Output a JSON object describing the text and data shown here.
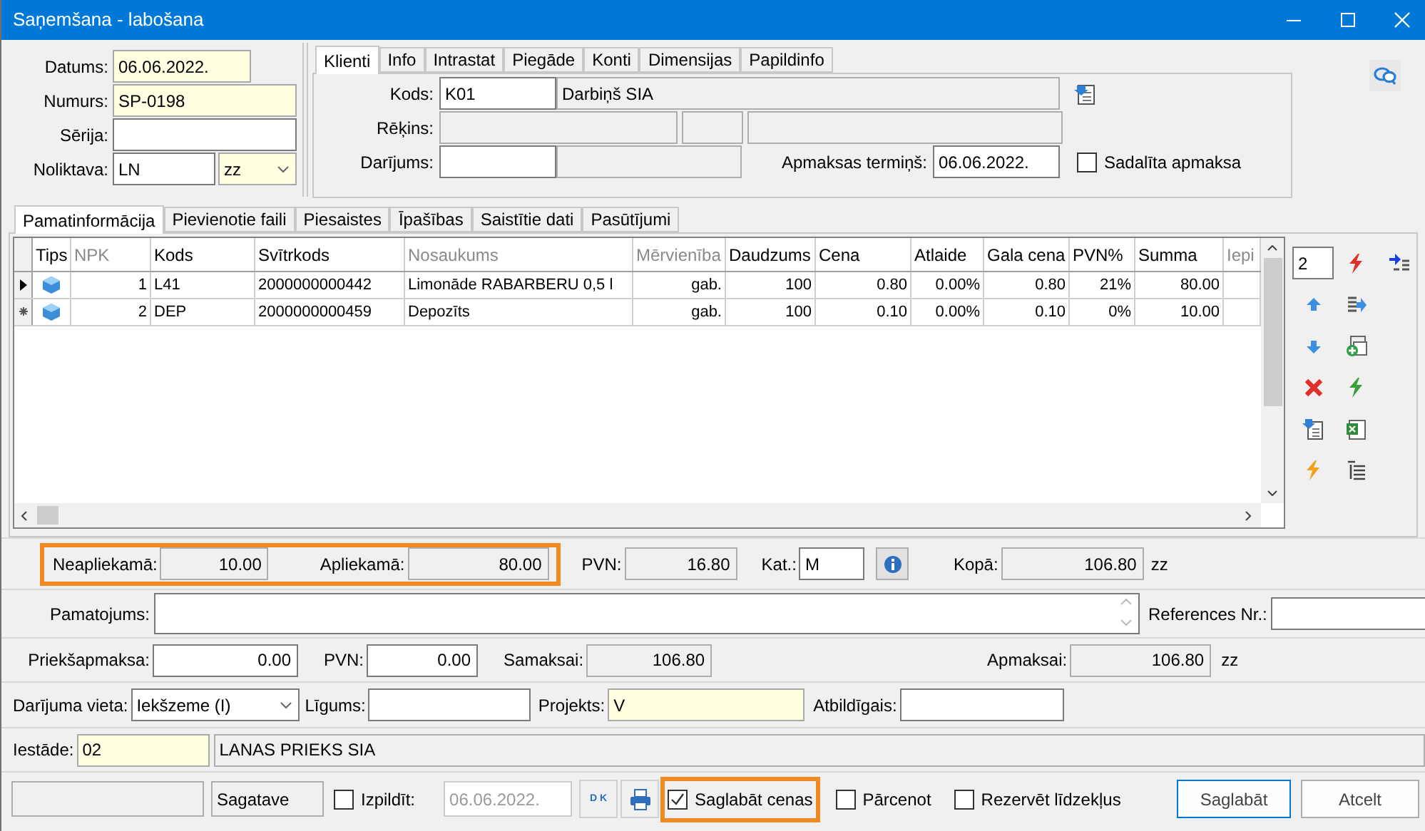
{
  "window": {
    "title": "Saņemšana - labošana"
  },
  "document_fields": [
    {
      "label": "Datums:",
      "value": "06.06.2022.",
      "kind": "text",
      "required": true,
      "readonly": false
    },
    {
      "label": "Numurs:",
      "value": "SP-0198",
      "kind": "text",
      "required": true,
      "readonly": false
    },
    {
      "label": "Sērija:",
      "kind": "text",
      "required": false,
      "readonly": false
    },
    {
      "label": "Noliktava:",
      "value": "LN",
      "kind": "text",
      "required": false,
      "readonly": false
    },
    {
      "value": "zz",
      "kind": "dropdown",
      "required": true,
      "readonly": false
    }
  ],
  "header_tabs": [
    {
      "label": "Klienti",
      "selected": true
    },
    {
      "label": "Info",
      "selected": false
    },
    {
      "label": "Intrastat",
      "selected": false
    },
    {
      "label": "Piegāde",
      "selected": false
    },
    {
      "label": "Konti",
      "selected": false
    },
    {
      "label": "Dimensijas",
      "selected": false
    },
    {
      "label": "Papildinfo",
      "selected": false
    }
  ],
  "client_fields": [
    {
      "label": "Kods:",
      "value": "K01",
      "required": false,
      "readonly": false
    },
    {
      "value": "Darbiņš SIA",
      "required": false,
      "readonly": true
    },
    {
      "label": "Rēķins:",
      "required": false,
      "readonly": true
    },
    {
      "required": false,
      "readonly": true
    },
    {
      "required": false,
      "readonly": true
    },
    {
      "label": "Darījums:",
      "required": false,
      "readonly": false
    },
    {
      "required": false,
      "readonly": true
    },
    {
      "label": "Apmaksas termiņš:",
      "value": "06.06.2022.",
      "required": false,
      "readonly": false
    }
  ],
  "split_payment": {
    "label": "Sadalīta apmaksa",
    "checked": false
  },
  "detail_tabs": [
    {
      "label": "Pamatinformācija",
      "selected": true
    },
    {
      "label": "Pievienotie faili",
      "selected": false
    },
    {
      "label": "Piesaistes",
      "selected": false
    },
    {
      "label": "Īpašības",
      "selected": false
    },
    {
      "label": "Saistītie dati",
      "selected": false
    },
    {
      "label": "Pasūtījumi",
      "selected": false
    }
  ],
  "table": {
    "columns": [
      {
        "label": "Tips",
        "dimmed": false
      },
      {
        "label": "NPK",
        "dimmed": true
      },
      {
        "label": "Kods",
        "dimmed": false
      },
      {
        "label": "Svītrkods",
        "dimmed": false
      },
      {
        "label": "Nosaukums",
        "dimmed": true
      },
      {
        "label": "Mērvienība",
        "dimmed": true
      },
      {
        "label": "Daudzums",
        "dimmed": false
      },
      {
        "label": "Cena",
        "dimmed": false
      },
      {
        "label": "Atlaide",
        "dimmed": false
      },
      {
        "label": "Gala cena",
        "dimmed": false
      },
      {
        "label": "PVN%",
        "dimmed": false
      },
      {
        "label": "Summa",
        "dimmed": false
      },
      {
        "label": "Iepi",
        "dimmed": true
      }
    ],
    "rows": [
      {
        "current": true,
        "new_row": false,
        "cells": [
          "",
          "1",
          "L41",
          "2000000000442",
          "Limonāde RABARBERU 0,5 l",
          "gab.",
          "100",
          "0.80",
          "0.00%",
          "0.80",
          "21%",
          "80.00"
        ]
      },
      {
        "current": false,
        "new_row": true,
        "cells": [
          "",
          "2",
          "DEP",
          "2000000000459",
          "Depozīts",
          "gab.",
          "100",
          "0.10",
          "0.00%",
          "0.10",
          "0%",
          "10.00"
        ]
      }
    ]
  },
  "line_count": "2",
  "totals": {
    "highlighted": true,
    "fields": [
      {
        "label": "Neapliekamā:",
        "value": "10.00",
        "required": false,
        "readonly": true
      },
      {
        "label": "Apliekamā:",
        "value": "80.00",
        "required": false,
        "readonly": true
      }
    ]
  },
  "summary_fields": [
    {
      "label": "PVN:",
      "value": "16.80",
      "required": false,
      "readonly": true
    },
    {
      "label": "Kat.:",
      "value": "M",
      "required": false,
      "readonly": false
    },
    {
      "label": "Kopā:",
      "value": "106.80",
      "required": false,
      "readonly": true
    }
  ],
  "summary_currency": "zz",
  "reason_fields": [
    {
      "label": "Pamatojums:",
      "kind": "memo",
      "required": false,
      "readonly": false
    },
    {
      "label": "References Nr.:",
      "kind": "text",
      "required": false,
      "readonly": false
    }
  ],
  "payment_fields": [
    {
      "label": "Priekšapmaksa:",
      "value": "0.00",
      "required": false,
      "readonly": false
    },
    {
      "label": "PVN:",
      "value": "0.00",
      "required": false,
      "readonly": false
    },
    {
      "label": "Samaksai:",
      "value": "106.80",
      "required": false,
      "readonly": true
    },
    {
      "label": "Apmaksai:",
      "value": "106.80",
      "required": false,
      "readonly": true
    }
  ],
  "payment_currency": "zz",
  "deal_fields": [
    {
      "label": "Darījuma vieta:",
      "value": "Iekšzeme (I)",
      "kind": "dropdown",
      "required": false,
      "readonly": false
    },
    {
      "label": "Līgums:",
      "kind": "text",
      "required": false,
      "readonly": false
    },
    {
      "label": "Projekts:",
      "value": "V",
      "kind": "text",
      "required": true,
      "readonly": false
    },
    {
      "label": "Atbildīgais:",
      "kind": "text",
      "required": false,
      "readonly": false
    }
  ],
  "institution_fields": [
    {
      "label": "Iestāde:",
      "value": "02",
      "required": true,
      "readonly": false
    },
    {
      "value": "LANAS PRIEKS SIA",
      "required": false,
      "readonly": true
    }
  ],
  "footer": {
    "status_fields": [
      {
        "required": false,
        "readonly": true
      },
      {
        "value": "Sagatave",
        "required": false,
        "readonly": true
      }
    ],
    "execute": {
      "label": "Izpildīt:",
      "checked": false
    },
    "execute_date": {
      "value": "06.06.2022.",
      "disabled": true
    },
    "dk_button": {
      "label": "D K"
    },
    "options": [
      {
        "label": "Saglabāt cenas",
        "checked": true,
        "highlighted": true
      },
      {
        "label": "Pārcenot",
        "checked": false,
        "highlighted": false
      },
      {
        "label": "Rezervēt līdzekļus",
        "checked": false,
        "highlighted": false
      }
    ],
    "buttons": [
      {
        "label": "Saglabāt",
        "default": true
      },
      {
        "label": "Atcelt",
        "default": false
      }
    ]
  }
}
